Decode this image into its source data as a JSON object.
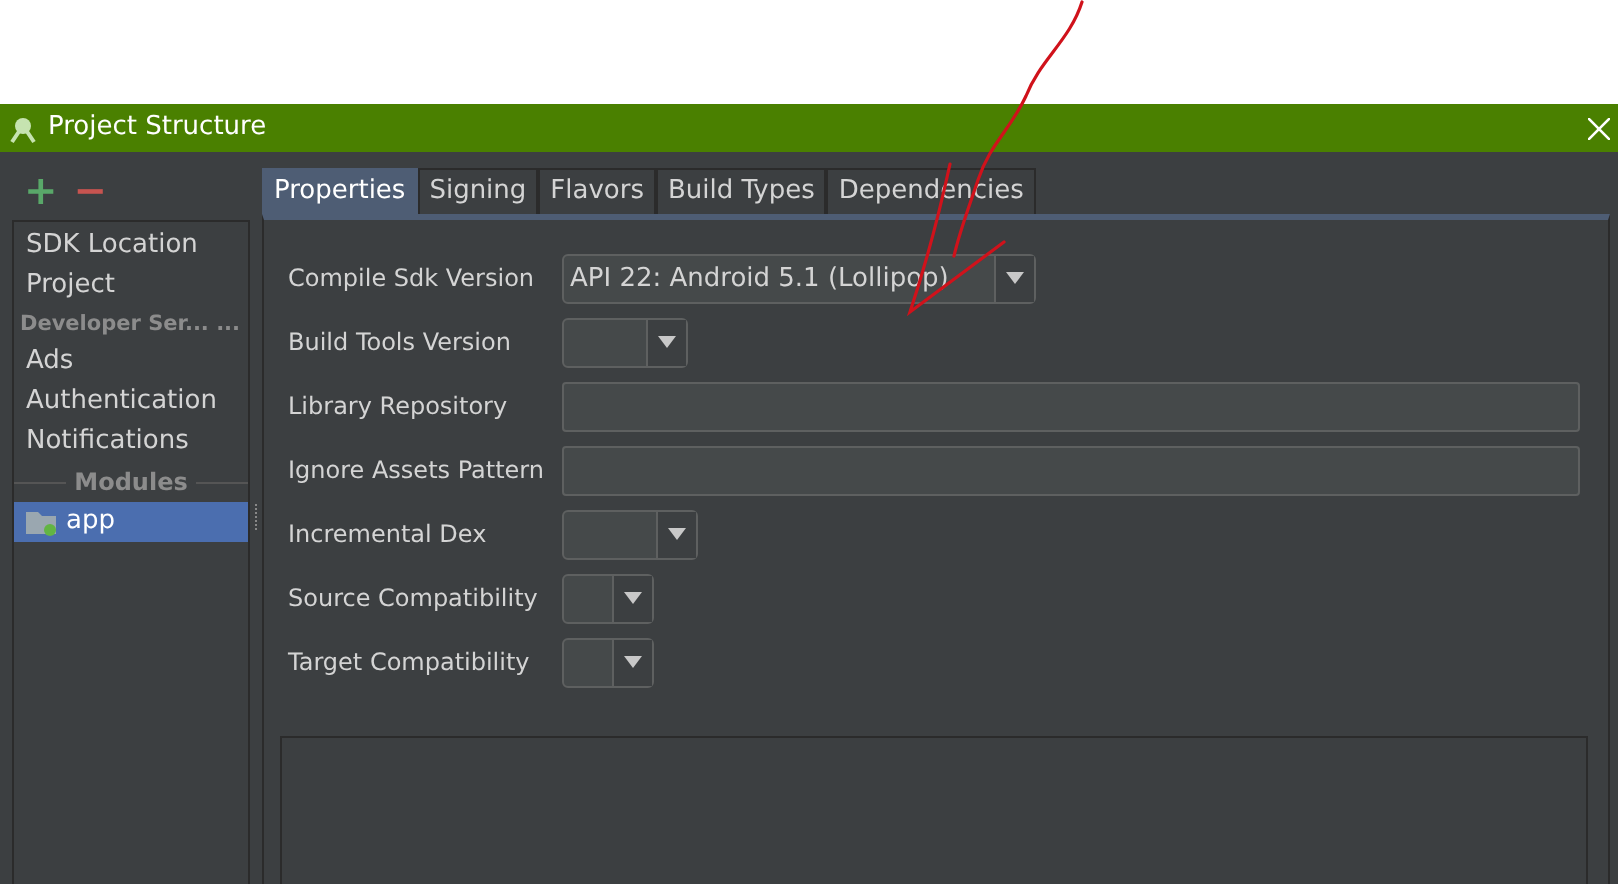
{
  "window": {
    "title": "Project Structure"
  },
  "toolbar": {
    "add": "+",
    "remove": "−"
  },
  "sidebar": {
    "items": [
      {
        "kind": "item",
        "label": "SDK Location",
        "selected": false
      },
      {
        "kind": "item",
        "label": "Project",
        "selected": false
      },
      {
        "kind": "header",
        "label": "Developer Ser... ..."
      },
      {
        "kind": "item",
        "label": "Ads",
        "selected": false
      },
      {
        "kind": "item",
        "label": "Authentication",
        "selected": false
      },
      {
        "kind": "item",
        "label": "Notifications",
        "selected": false
      },
      {
        "kind": "section",
        "label": "Modules"
      },
      {
        "kind": "module",
        "label": "app",
        "selected": true
      }
    ]
  },
  "tabs": [
    {
      "label": "Properties",
      "selected": true
    },
    {
      "label": "Signing",
      "selected": false
    },
    {
      "label": "Flavors",
      "selected": false
    },
    {
      "label": "Build Types",
      "selected": false
    },
    {
      "label": "Dependencies",
      "selected": false
    }
  ],
  "form": [
    {
      "kind": "combo",
      "label": "Compile Sdk Version",
      "value": "API 22: Android 5.1 (Lollipop)"
    },
    {
      "kind": "combo",
      "label": "Build Tools Version"
    },
    {
      "kind": "text",
      "label": "Library Repository"
    },
    {
      "kind": "text",
      "label": "Ignore Assets Pattern"
    },
    {
      "kind": "combo",
      "label": "Incremental Dex"
    },
    {
      "kind": "combo",
      "label": "Source Compatibility"
    },
    {
      "kind": "combo",
      "label": "Target Compatibility"
    }
  ]
}
